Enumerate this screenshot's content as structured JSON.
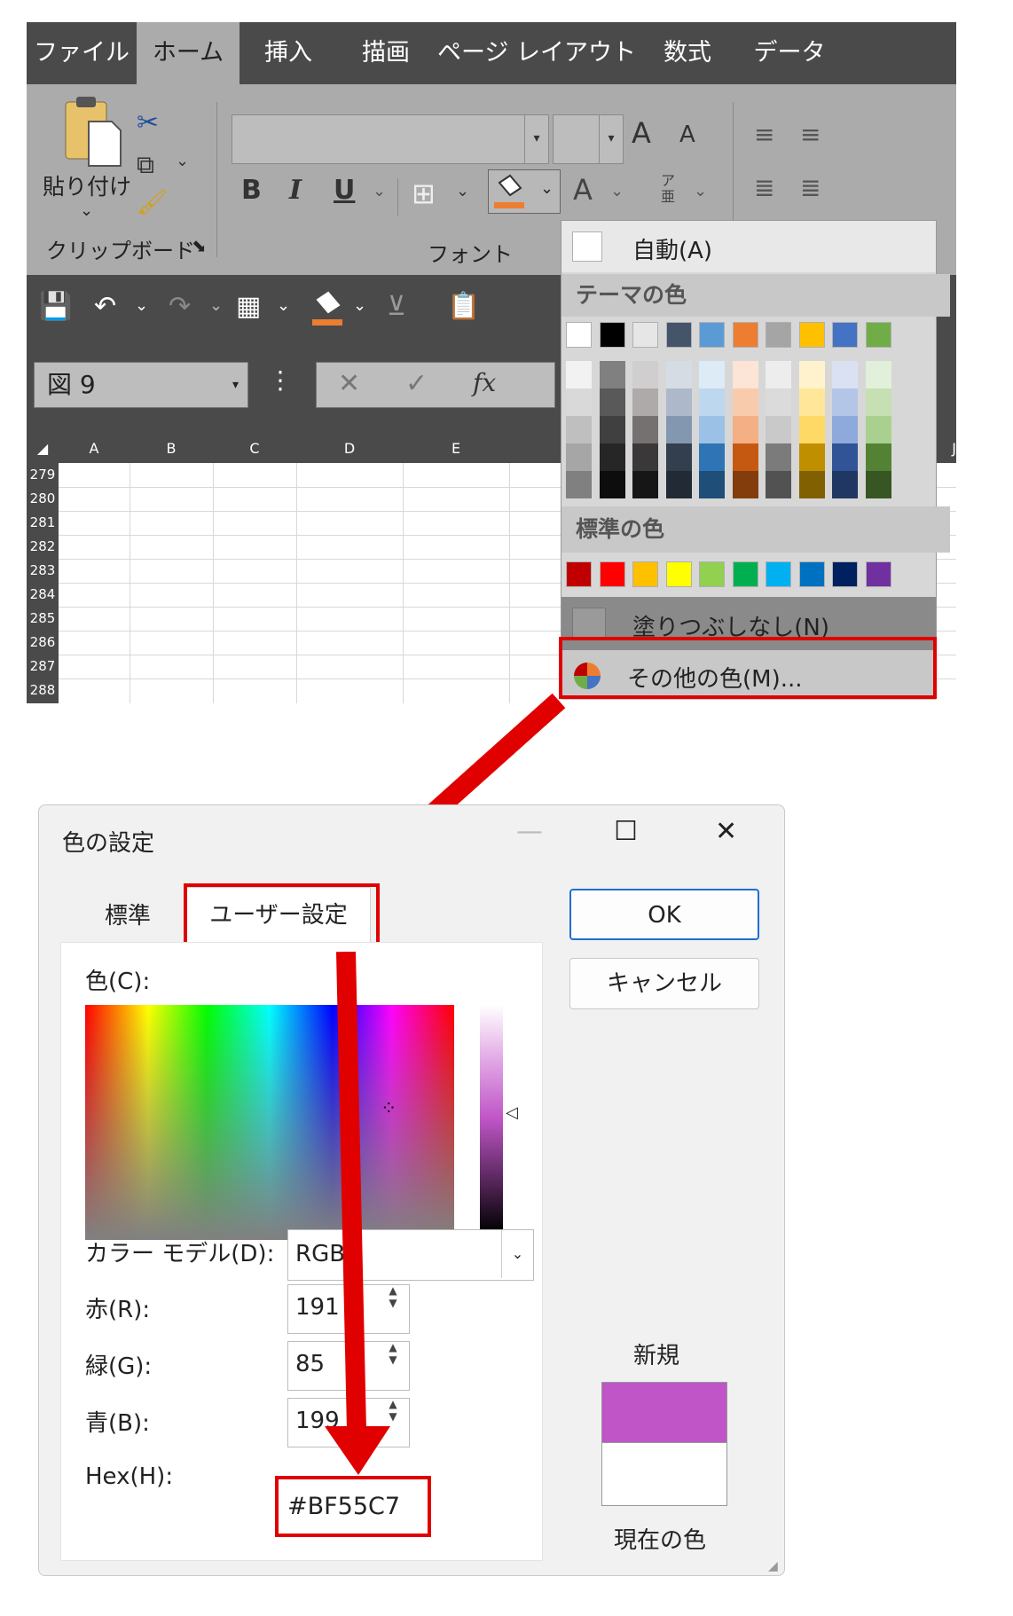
{
  "ribbon": {
    "tabs": [
      "ファイル",
      "ホーム",
      "挿入",
      "描画",
      "ページ レイアウト",
      "数式",
      "データ"
    ],
    "active_tab": "ホーム",
    "paste_label": "貼り付け",
    "clipboard_group": "クリップボード",
    "font_group": "フォント",
    "bold": "B",
    "italic": "I",
    "underline": "U",
    "font_color_glyph": "A",
    "increase_font": "A",
    "decrease_font": "A",
    "phonetic": "ア亜"
  },
  "formula_bar": {
    "name_box": "図 9",
    "fx": "fx"
  },
  "sheet": {
    "columns": [
      "A",
      "B",
      "C",
      "D",
      "E"
    ],
    "last_column_partial": "J",
    "rows": [
      "279",
      "280",
      "281",
      "282",
      "283",
      "284",
      "285",
      "286",
      "287",
      "288"
    ]
  },
  "fill_dropdown": {
    "auto_label": "自動(A)",
    "theme_header": "テーマの色",
    "theme_colors": [
      "#ffffff",
      "#000000",
      "#e7e6e6",
      "#44546a",
      "#5b9bd5",
      "#ed7d31",
      "#a5a5a5",
      "#ffc000",
      "#4472c4",
      "#70ad47"
    ],
    "theme_shades": [
      [
        "#f2f2f2",
        "#d9d9d9",
        "#bfbfbf",
        "#a6a6a6",
        "#808080"
      ],
      [
        "#808080",
        "#595959",
        "#404040",
        "#262626",
        "#0d0d0d"
      ],
      [
        "#d0cece",
        "#aeaaaa",
        "#757171",
        "#3a3838",
        "#171616"
      ],
      [
        "#d6dce4",
        "#adb9ca",
        "#8497b0",
        "#333f4f",
        "#222a35"
      ],
      [
        "#ddebf7",
        "#bdd7ee",
        "#9bc2e6",
        "#2f75b5",
        "#1f4e78"
      ],
      [
        "#fce4d6",
        "#f8cbad",
        "#f4b084",
        "#c65911",
        "#833c0b"
      ],
      [
        "#ededed",
        "#dbdbdb",
        "#c9c9c9",
        "#7b7b7b",
        "#525252"
      ],
      [
        "#fff2cc",
        "#ffe699",
        "#ffd966",
        "#bf8f00",
        "#806000"
      ],
      [
        "#d9e1f2",
        "#b4c6e7",
        "#8ea9db",
        "#305496",
        "#203764"
      ],
      [
        "#e2efda",
        "#c6e0b4",
        "#a9d08e",
        "#548235",
        "#375623"
      ]
    ],
    "standard_header": "標準の色",
    "standard_colors": [
      "#c00000",
      "#ff0000",
      "#ffc000",
      "#ffff00",
      "#92d050",
      "#00b050",
      "#00b0f0",
      "#0070c0",
      "#002060",
      "#7030a0"
    ],
    "no_fill_label": "塗りつぶしなし(N)",
    "more_colors_label": "その他の色(M)..."
  },
  "dialog": {
    "title": "色の設定",
    "tab_standard": "標準",
    "tab_custom": "ユーザー設定",
    "color_label": "色(C):",
    "model_label": "カラー モデル(D):",
    "model_value": "RGB",
    "red_label": "赤(R):",
    "red_value": "191",
    "green_label": "緑(G):",
    "green_value": "85",
    "blue_label": "青(B):",
    "blue_value": "199",
    "hex_label": "Hex(H):",
    "hex_value": "#BF55C7",
    "ok": "OK",
    "cancel": "キャンセル",
    "new_label": "新規",
    "current_label": "現在の色",
    "new_color": "#bf55c7",
    "current_color": "#ffffff"
  }
}
